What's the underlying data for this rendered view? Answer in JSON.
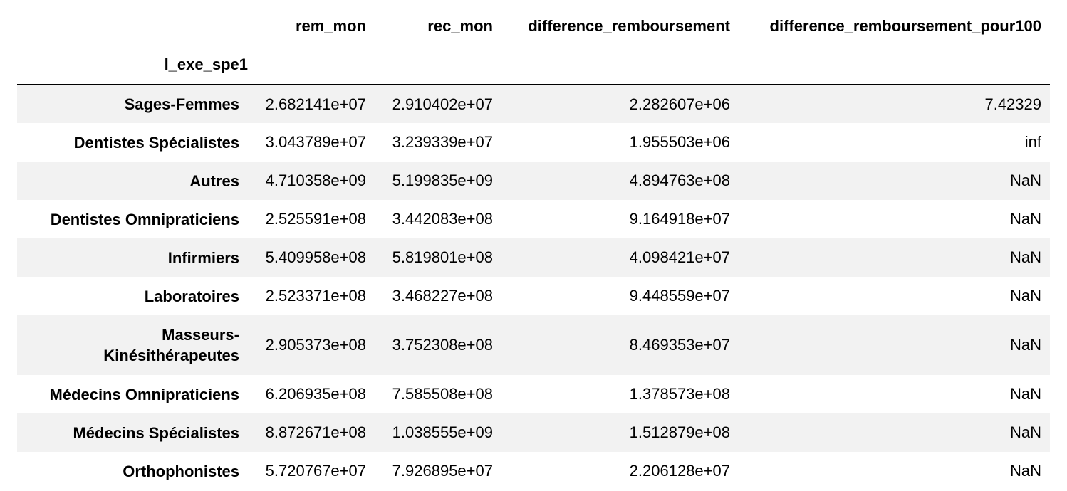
{
  "table": {
    "index_name": "l_exe_spe1",
    "columns": [
      "rem_mon",
      "rec_mon",
      "difference_remboursement",
      "difference_remboursement_pour100"
    ],
    "rows": [
      {
        "label": "Sages-Femmes",
        "rem_mon": "2.682141e+07",
        "rec_mon": "2.910402e+07",
        "difference_remboursement": "2.282607e+06",
        "difference_remboursement_pour100": "7.42329"
      },
      {
        "label": "Dentistes Spécialistes",
        "rem_mon": "3.043789e+07",
        "rec_mon": "3.239339e+07",
        "difference_remboursement": "1.955503e+06",
        "difference_remboursement_pour100": "inf"
      },
      {
        "label": "Autres",
        "rem_mon": "4.710358e+09",
        "rec_mon": "5.199835e+09",
        "difference_remboursement": "4.894763e+08",
        "difference_remboursement_pour100": "NaN"
      },
      {
        "label": "Dentistes Omnipraticiens",
        "rem_mon": "2.525591e+08",
        "rec_mon": "3.442083e+08",
        "difference_remboursement": "9.164918e+07",
        "difference_remboursement_pour100": "NaN"
      },
      {
        "label": "Infirmiers",
        "rem_mon": "5.409958e+08",
        "rec_mon": "5.819801e+08",
        "difference_remboursement": "4.098421e+07",
        "difference_remboursement_pour100": "NaN"
      },
      {
        "label": "Laboratoires",
        "rem_mon": "2.523371e+08",
        "rec_mon": "3.468227e+08",
        "difference_remboursement": "9.448559e+07",
        "difference_remboursement_pour100": "NaN"
      },
      {
        "label_line1": "Masseurs-",
        "label_line2": "Kinésithérapeutes",
        "rem_mon": "2.905373e+08",
        "rec_mon": "3.752308e+08",
        "difference_remboursement": "8.469353e+07",
        "difference_remboursement_pour100": "NaN"
      },
      {
        "label": "Médecins Omnipraticiens",
        "rem_mon": "6.206935e+08",
        "rec_mon": "7.585508e+08",
        "difference_remboursement": "1.378573e+08",
        "difference_remboursement_pour100": "NaN"
      },
      {
        "label": "Médecins Spécialistes",
        "rem_mon": "8.872671e+08",
        "rec_mon": "1.038555e+09",
        "difference_remboursement": "1.512879e+08",
        "difference_remboursement_pour100": "NaN"
      },
      {
        "label": "Orthophonistes",
        "rem_mon": "5.720767e+07",
        "rec_mon": "7.926895e+07",
        "difference_remboursement": "2.206128e+07",
        "difference_remboursement_pour100": "NaN"
      }
    ]
  }
}
